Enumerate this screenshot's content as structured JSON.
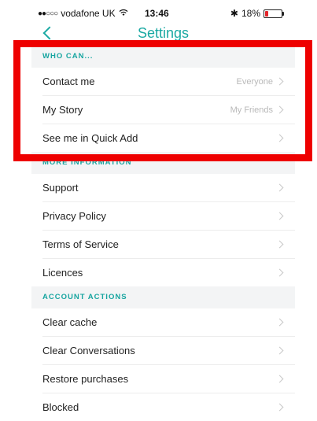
{
  "status_bar": {
    "signal": "●●○○○",
    "carrier": "vodafone UK",
    "wifi_icon": "wifi-icon",
    "time": "13:46",
    "bluetooth": "✱",
    "battery_percent": "18%",
    "battery_level": 0.18,
    "battery_color": "#e4262b"
  },
  "nav": {
    "back_icon": "chevron-left-icon",
    "title": "Settings"
  },
  "accent_color": "#1aa9a3",
  "highlight_color": "#ee0000",
  "sections": [
    {
      "header": "WHO CAN...",
      "rows": [
        {
          "label": "Contact me",
          "value": "Everyone"
        },
        {
          "label": "My Story",
          "value": "My Friends"
        },
        {
          "label": "See me in Quick Add",
          "value": ""
        }
      ]
    },
    {
      "header": "MORE INFORMATION",
      "rows": [
        {
          "label": "Support",
          "value": ""
        },
        {
          "label": "Privacy Policy",
          "value": ""
        },
        {
          "label": "Terms of Service",
          "value": ""
        },
        {
          "label": "Licences",
          "value": ""
        }
      ]
    },
    {
      "header": "ACCOUNT ACTIONS",
      "rows": [
        {
          "label": "Clear cache",
          "value": ""
        },
        {
          "label": "Clear Conversations",
          "value": ""
        },
        {
          "label": "Restore purchases",
          "value": ""
        },
        {
          "label": "Blocked",
          "value": ""
        }
      ]
    }
  ]
}
